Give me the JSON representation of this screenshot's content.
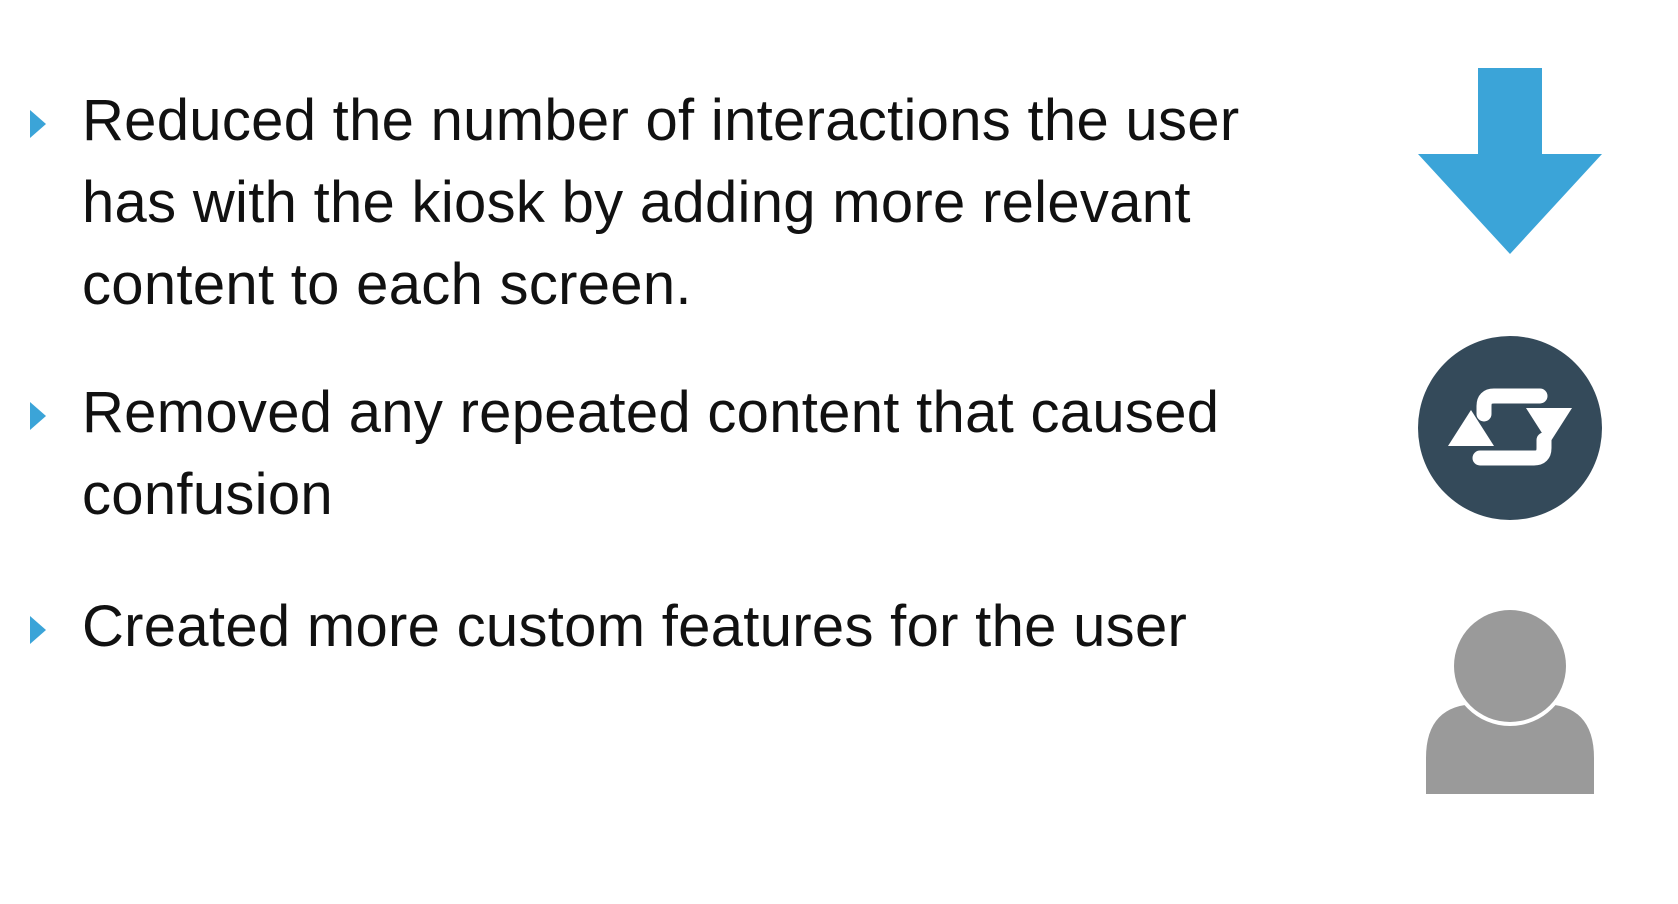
{
  "bullets": [
    {
      "text": "Reduced the number of interactions the user has with the kiosk by adding more relevant content to each screen."
    },
    {
      "text": "Removed any repeated content that caused confusion"
    },
    {
      "text": "Created more custom features for the user"
    }
  ],
  "icons": {
    "down": "arrow-down-icon",
    "repeat": "repeat-icon",
    "user": "user-icon"
  },
  "colors": {
    "accent_blue": "#3ba4d8",
    "dark_slate": "#344a5a",
    "user_gray": "#9a9a9a",
    "text": "#111111",
    "background": "#ffffff"
  }
}
